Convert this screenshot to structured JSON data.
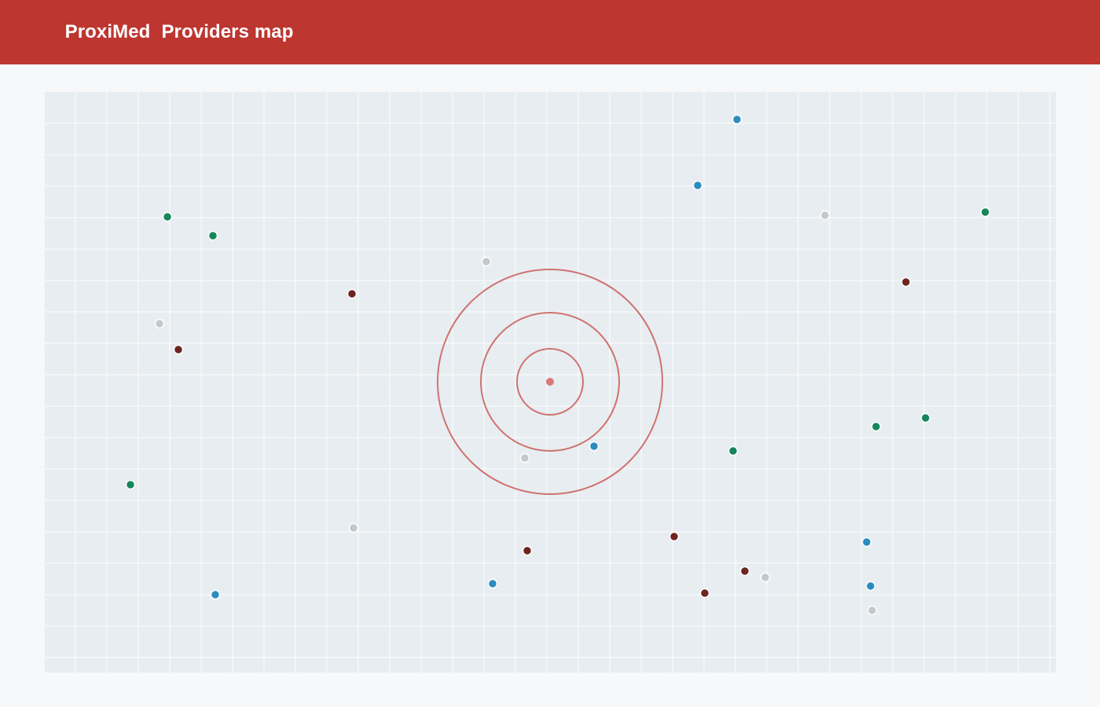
{
  "header": {
    "app_name": "ProxiMed",
    "page_title": "Providers map"
  },
  "colors": {
    "header_bg": "#bd3630",
    "map_bg": "#e8edf1",
    "grid_line": "#ffffff",
    "radius_ring": "#cf7371",
    "center_marker": "#d77a7a",
    "category_green": "#15875a",
    "category_blue": "#2b8cbe",
    "category_maroon": "#6e2420",
    "category_gray": "#c4c7cb"
  },
  "map": {
    "center_marker_icon": "location-center-icon",
    "radius_rings": 3,
    "providers": [
      {
        "category": "blue"
      },
      {
        "category": "blue"
      },
      {
        "category": "gray"
      },
      {
        "category": "green"
      },
      {
        "category": "green"
      },
      {
        "category": "green"
      },
      {
        "category": "gray"
      },
      {
        "category": "maroon"
      },
      {
        "category": "maroon"
      },
      {
        "category": "gray"
      },
      {
        "category": "maroon"
      },
      {
        "category": "green"
      },
      {
        "category": "green"
      },
      {
        "category": "blue"
      },
      {
        "category": "gray"
      },
      {
        "category": "green"
      },
      {
        "category": "green"
      },
      {
        "category": "gray"
      },
      {
        "category": "maroon"
      },
      {
        "category": "blue"
      },
      {
        "category": "maroon"
      },
      {
        "category": "blue"
      },
      {
        "category": "maroon"
      },
      {
        "category": "gray"
      },
      {
        "category": "blue"
      },
      {
        "category": "maroon"
      },
      {
        "category": "blue"
      },
      {
        "category": "gray"
      }
    ]
  }
}
